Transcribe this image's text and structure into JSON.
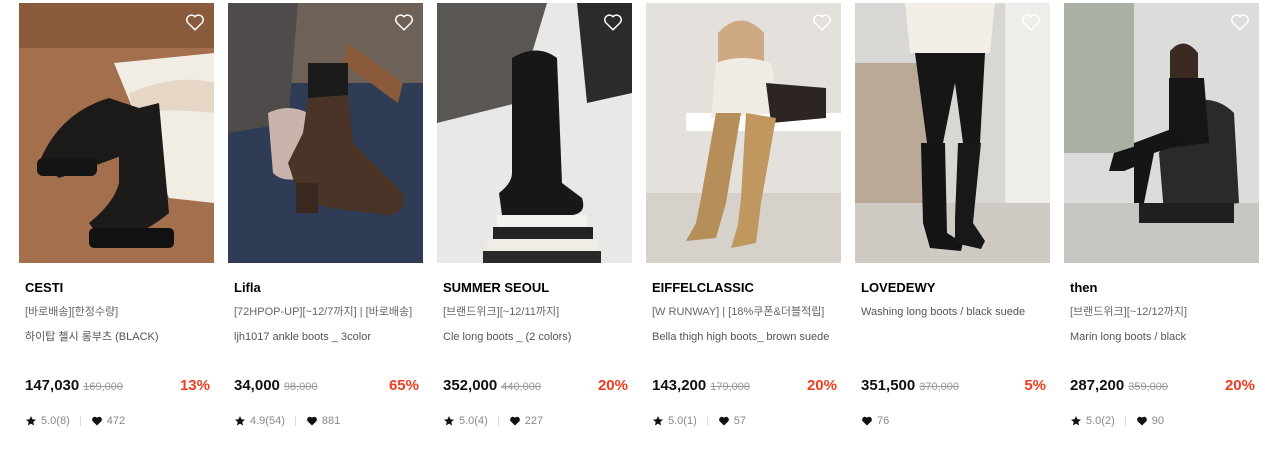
{
  "colors": {
    "discount": "#f03c1e",
    "price": "#111111",
    "original_price": "#999999"
  },
  "icons": {
    "wishlist": "heart-outline-icon",
    "rating": "star-icon",
    "likes": "heart-filled-icon"
  },
  "products": [
    {
      "brand": "CESTI",
      "promo": "[바로배송][한정수량]",
      "name": "하이탑 첼시 롱부츠 (BLACK)",
      "price": "147,030",
      "original_price": "169,000",
      "discount": "13%",
      "rating": "5.0(8)",
      "likes": "472"
    },
    {
      "brand": "Lifla",
      "promo": "[72HPOP-UP][~12/7까지] | [바로배송]",
      "name": "ljh1017 ankle boots _ 3color",
      "price": "34,000",
      "original_price": "98,000",
      "discount": "65%",
      "rating": "4.9(54)",
      "likes": "881"
    },
    {
      "brand": "SUMMER SEOUL",
      "promo": "[브랜드위크][~12/11까지]",
      "name": "Cle long boots _ (2 colors)",
      "price": "352,000",
      "original_price": "440,000",
      "discount": "20%",
      "rating": "5.0(4)",
      "likes": "227"
    },
    {
      "brand": "EIFFELCLASSIC",
      "promo": "[W RUNWAY] | [18%쿠폰&더블적립]",
      "name": "Bella thigh high boots_ brown suede",
      "price": "143,200",
      "original_price": "179,000",
      "discount": "20%",
      "rating": "5.0(1)",
      "likes": "57"
    },
    {
      "brand": "LOVEDEWY",
      "promo": "",
      "name": "Washing long boots / black suede",
      "price": "351,500",
      "original_price": "370,000",
      "discount": "5%",
      "rating": "",
      "likes": "76"
    },
    {
      "brand": "then",
      "promo": "[브랜드위크][~12/12까지]",
      "name": "Marin long boots / black",
      "price": "287,200",
      "original_price": "359,000",
      "discount": "20%",
      "rating": "5.0(2)",
      "likes": "90"
    }
  ]
}
